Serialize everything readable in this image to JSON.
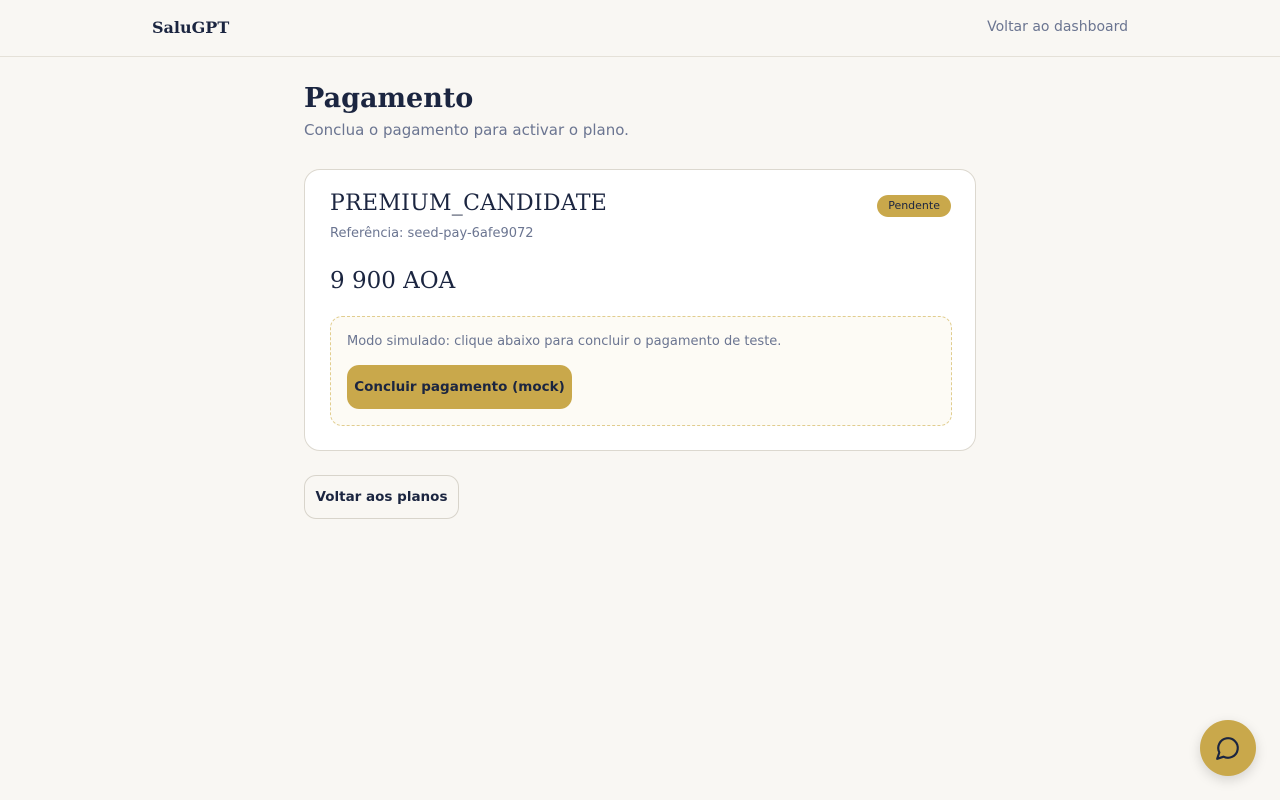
{
  "header": {
    "brand": "SaluGPT",
    "dashboard_link": "Voltar ao dashboard"
  },
  "page": {
    "title": "Pagamento",
    "subtitle": "Conclua o pagamento para activar o plano."
  },
  "payment": {
    "plan_name": "PREMIUM_CANDIDATE",
    "status": "Pendente",
    "reference": "Referência: seed-pay-6afe9072",
    "amount": "9 900 AOA",
    "mock_text": "Modo simulado: clique abaixo para concluir o pagamento de teste.",
    "mock_button": "Concluir pagamento (mock)"
  },
  "actions": {
    "back_button": "Voltar aos planos"
  },
  "chat": {
    "icon": "chat-bubble-icon"
  },
  "colors": {
    "accent": "#c9a84b",
    "navy": "#1b2540",
    "muted": "#6b7591",
    "background": "#f9f7f3"
  }
}
